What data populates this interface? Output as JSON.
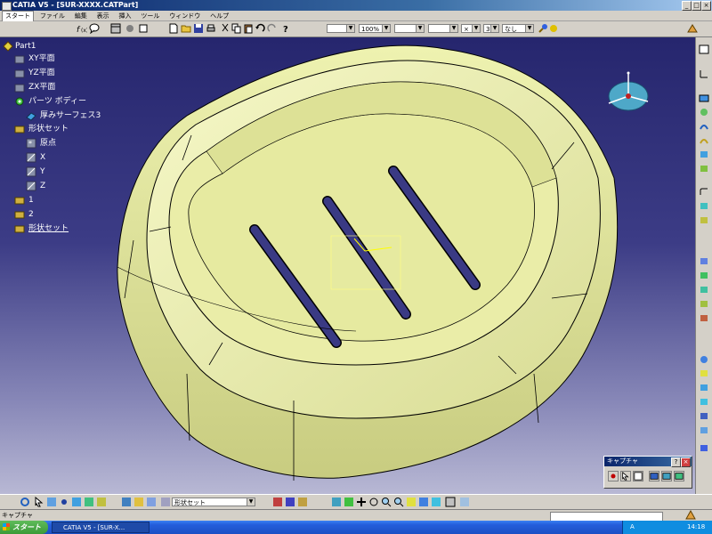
{
  "window": {
    "title": "CATIA V5 - [SUR-XXXX.CATPart]"
  },
  "menu": {
    "start": "スタート",
    "items": [
      "ファイル",
      "編集",
      "表示",
      "挿入",
      "ツール",
      "ウィンドウ",
      "ヘルプ"
    ]
  },
  "toolbar": {
    "zoom_value": "100%",
    "layer_value": "なし",
    "linetype_value": "3"
  },
  "tree": {
    "root": "Part1",
    "xy": "XY平面",
    "yz": "YZ平面",
    "zx": "ZX平面",
    "partbody": "パーツ ボディー",
    "thick": "厚みサーフェス3",
    "geoset": "形状セット",
    "origin": "原点",
    "x": "X",
    "y": "Y",
    "z": "Z",
    "item1": "1",
    "item2": "2",
    "geoset2": "形状セット"
  },
  "bottom_toolbar": {
    "workbench_value": "形状セット"
  },
  "status": {
    "text": "キャプチャ"
  },
  "capture": {
    "title": "キャプチャ"
  },
  "taskbar": {
    "start": "スタート",
    "item": "CATIA V5 - [SUR-X...",
    "clock": "14:18"
  },
  "colors": {
    "model": "#e8eca4",
    "background_top": "#26266e",
    "background_bottom": "#b8b8d4"
  }
}
